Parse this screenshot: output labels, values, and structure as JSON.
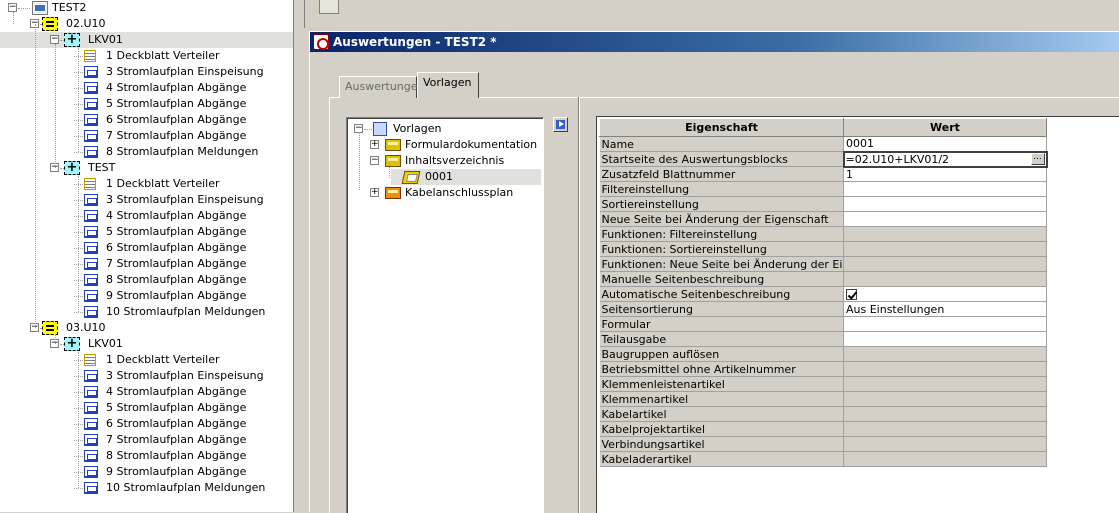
{
  "project_tree": {
    "root": "TEST2",
    "items": [
      {
        "label": "02.U10",
        "type": "function",
        "level": 1
      },
      {
        "label": "LKV01",
        "type": "location",
        "level": 2,
        "selected": true
      },
      {
        "label": "1 Deckblatt Verteiler",
        "type": "cover",
        "level": 3
      },
      {
        "label": "3 Stromlaufplan Einspeisung",
        "type": "circuit",
        "level": 3
      },
      {
        "label": "4 Stromlaufplan Abgänge",
        "type": "circuit",
        "level": 3
      },
      {
        "label": "5 Stromlaufplan Abgänge",
        "type": "circuit",
        "level": 3
      },
      {
        "label": "6 Stromlaufplan Abgänge",
        "type": "circuit",
        "level": 3
      },
      {
        "label": "7 Stromlaufplan Abgänge",
        "type": "circuit",
        "level": 3
      },
      {
        "label": "8 Stromlaufplan Meldungen",
        "type": "circuit",
        "level": 3
      },
      {
        "label": "TEST",
        "type": "location",
        "level": 2
      },
      {
        "label": "1 Deckblatt Verteiler",
        "type": "cover",
        "level": 3
      },
      {
        "label": "3 Stromlaufplan Einspeisung",
        "type": "circuit",
        "level": 3
      },
      {
        "label": "4 Stromlaufplan Abgänge",
        "type": "circuit",
        "level": 3
      },
      {
        "label": "5 Stromlaufplan Abgänge",
        "type": "circuit",
        "level": 3
      },
      {
        "label": "6 Stromlaufplan Abgänge",
        "type": "circuit",
        "level": 3
      },
      {
        "label": "7 Stromlaufplan Abgänge",
        "type": "circuit",
        "level": 3
      },
      {
        "label": "8 Stromlaufplan Abgänge",
        "type": "circuit",
        "level": 3
      },
      {
        "label": "9 Stromlaufplan Abgänge",
        "type": "circuit",
        "level": 3
      },
      {
        "label": "10 Stromlaufplan Meldungen",
        "type": "circuit",
        "level": 3
      },
      {
        "label": "03.U10",
        "type": "function",
        "level": 1
      },
      {
        "label": "LKV01",
        "type": "location",
        "level": 2
      },
      {
        "label": "1 Deckblatt Verteiler",
        "type": "cover",
        "level": 3
      },
      {
        "label": "3 Stromlaufplan Einspeisung",
        "type": "circuit",
        "level": 3
      },
      {
        "label": "4 Stromlaufplan Abgänge",
        "type": "circuit",
        "level": 3
      },
      {
        "label": "5 Stromlaufplan Abgänge",
        "type": "circuit",
        "level": 3
      },
      {
        "label": "6 Stromlaufplan Abgänge",
        "type": "circuit",
        "level": 3
      },
      {
        "label": "7 Stromlaufplan Abgänge",
        "type": "circuit",
        "level": 3
      },
      {
        "label": "8 Stromlaufplan Abgänge",
        "type": "circuit",
        "level": 3
      },
      {
        "label": "9 Stromlaufplan Abgänge",
        "type": "circuit",
        "level": 3
      },
      {
        "label": "10 Stromlaufplan Meldungen",
        "type": "circuit",
        "level": 3
      }
    ]
  },
  "dialog": {
    "title": "Auswertungen - TEST2 *",
    "tabs": [
      {
        "label": "Auswertungen",
        "active": false
      },
      {
        "label": "Vorlagen",
        "active": true
      }
    ],
    "template_tree": {
      "root": "Vorlagen",
      "items": [
        {
          "label": "Formulardokumentation",
          "level": 1,
          "expander": "+"
        },
        {
          "label": "Inhaltsverzeichnis",
          "level": 1,
          "expander": "-"
        },
        {
          "label": "0001",
          "level": 2,
          "selected": true
        },
        {
          "label": "Kabelanschlussplan",
          "level": 1,
          "expander": "+"
        }
      ]
    },
    "property_grid": {
      "header_property": "Eigenschaft",
      "header_value": "Wert",
      "rows": [
        {
          "name": "Name",
          "value": "0001",
          "editable": true
        },
        {
          "name": "Startseite des Auswertungsblocks",
          "value": "=02.U10+LKV01/2",
          "editable": true,
          "active": true,
          "has_button": true
        },
        {
          "name": "Zusatzfeld Blattnummer",
          "value": "1",
          "editable": true
        },
        {
          "name": "Filtereinstellung",
          "value": "",
          "editable": true
        },
        {
          "name": "Sortiereinstellung",
          "value": "",
          "editable": true
        },
        {
          "name": "Neue Seite bei Änderung der Eigenschaft",
          "value": "",
          "editable": true
        },
        {
          "name": "Funktionen: Filtereinstellung",
          "value": "",
          "editable": false
        },
        {
          "name": "Funktionen: Sortiereinstellung",
          "value": "",
          "editable": false
        },
        {
          "name": "Funktionen: Neue Seite bei Änderung der Eigen…",
          "value": "",
          "editable": false
        },
        {
          "name": "Manuelle Seitenbeschreibung",
          "value": "",
          "editable": false
        },
        {
          "name": "Automatische Seitenbeschreibung",
          "value": "",
          "editable": true,
          "checkbox": true,
          "checked": true
        },
        {
          "name": "Seitensortierung",
          "value": "Aus Einstellungen",
          "editable": true
        },
        {
          "name": "Formular",
          "value": "",
          "editable": true
        },
        {
          "name": "Teilausgabe",
          "value": "",
          "editable": true
        },
        {
          "name": "Baugruppen auflösen",
          "value": "",
          "editable": false
        },
        {
          "name": "Betriebsmittel ohne Artikelnummer",
          "value": "",
          "editable": false
        },
        {
          "name": "Klemmenleistenartikel",
          "value": "",
          "editable": false
        },
        {
          "name": "Klemmenartikel",
          "value": "",
          "editable": false
        },
        {
          "name": "Kabelartikel",
          "value": "",
          "editable": false
        },
        {
          "name": "Kabelprojektartikel",
          "value": "",
          "editable": false
        },
        {
          "name": "Verbindungsartikel",
          "value": "",
          "editable": false
        },
        {
          "name": "Kabeladerartikel",
          "value": "",
          "editable": false
        }
      ]
    }
  }
}
